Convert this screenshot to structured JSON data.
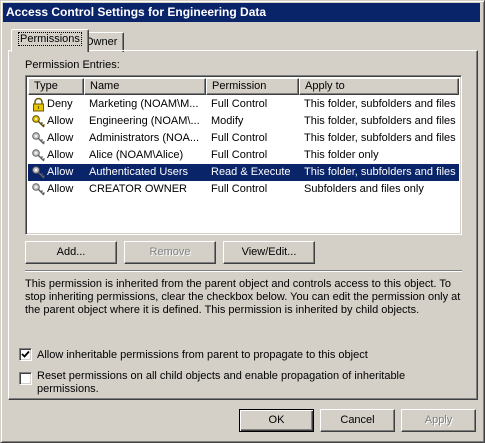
{
  "window": {
    "title": "Access Control Settings for Engineering Data"
  },
  "tabs": [
    {
      "label": "Permissions",
      "active": true
    },
    {
      "label": "Owner",
      "active": false
    }
  ],
  "permission_entries": {
    "label": "Permission Entries:",
    "columns": [
      "Type",
      "Name",
      "Permission",
      "Apply to"
    ],
    "rows": [
      {
        "icon": "lock-icon",
        "type": "Deny",
        "name": "Marketing (NOAM\\M...",
        "permission": "Full Control",
        "apply_to": "This folder, subfolders and files",
        "selected": false
      },
      {
        "icon": "key-icon",
        "type": "Allow",
        "name": "Engineering (NOAM\\...",
        "permission": "Modify",
        "apply_to": "This folder, subfolders and files",
        "selected": false
      },
      {
        "icon": "inherited-key-icon",
        "type": "Allow",
        "name": "Administrators (NOA...",
        "permission": "Full Control",
        "apply_to": "This folder, subfolders and files",
        "selected": false
      },
      {
        "icon": "inherited-key-icon",
        "type": "Allow",
        "name": "Alice (NOAM\\Alice)",
        "permission": "Full Control",
        "apply_to": "This folder only",
        "selected": false
      },
      {
        "icon": "inherited-key-icon",
        "type": "Allow",
        "name": "Authenticated Users",
        "permission": "Read & Execute",
        "apply_to": "This folder, subfolders and files",
        "selected": true
      },
      {
        "icon": "inherited-key-icon",
        "type": "Allow",
        "name": "CREATOR OWNER",
        "permission": "Full Control",
        "apply_to": "Subfolders and files only",
        "selected": false
      }
    ]
  },
  "buttons": {
    "add": "Add...",
    "remove": "Remove",
    "view_edit": "View/Edit...",
    "ok": "OK",
    "cancel": "Cancel",
    "apply": "Apply"
  },
  "info_text": "This permission is inherited from the parent object and controls access to this object.  To stop inheriting permissions, clear the checkbox below.  You can edit the permission only at the parent object where it is defined. This permission is inherited by child objects.",
  "checkboxes": [
    {
      "label": "Allow inheritable permissions from parent to propagate to this object",
      "checked": true
    },
    {
      "label": "Reset permissions on all child objects and enable propagation of inheritable permissions.",
      "checked": false
    }
  ],
  "colors": {
    "titlebar": "#0a246a",
    "selection": "#0a246a",
    "face": "#d4d0c8"
  }
}
